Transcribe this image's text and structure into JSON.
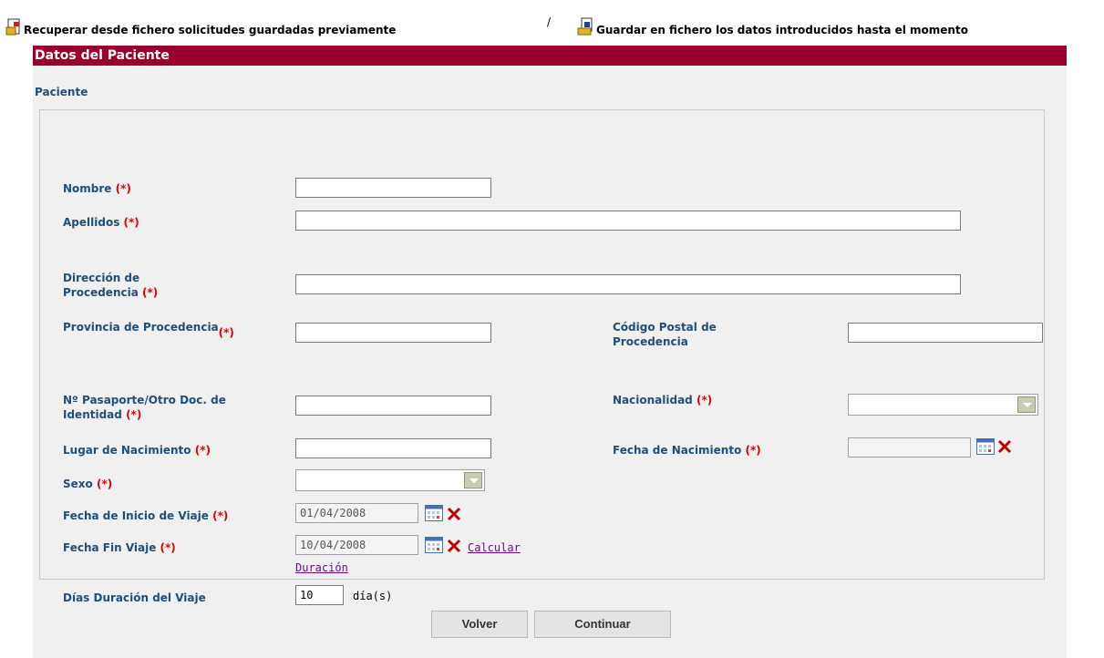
{
  "toolbar": {
    "recover_label": "Recuperar desde fichero solicitudes guardadas previamente",
    "separator": "/",
    "save_label": "Guardar en fichero los datos introducidos hasta el momento"
  },
  "panel": {
    "header": "Datos del Paciente",
    "section": "Paciente"
  },
  "form": {
    "required_marker": "(*)",
    "nombre": {
      "label": "Nombre",
      "value": ""
    },
    "apellidos": {
      "label": "Apellidos",
      "value": ""
    },
    "direccion": {
      "label_line1": "Dirección de",
      "label_line2": "Procedencia",
      "value": ""
    },
    "provincia": {
      "label": "Provincia de Procedencia",
      "value": ""
    },
    "codigo_postal": {
      "label_line1": "Código Postal de",
      "label_line2": "Procedencia",
      "value": ""
    },
    "pasaporte": {
      "label_line1": "Nº Pasaporte/Otro Doc. de",
      "label_line2": "Identidad",
      "value": ""
    },
    "nacionalidad": {
      "label": "Nacionalidad",
      "value": ""
    },
    "lugar_nacimiento": {
      "label": "Lugar de Nacimiento",
      "value": ""
    },
    "fecha_nacimiento": {
      "label": "Fecha de Nacimiento",
      "value": ""
    },
    "sexo": {
      "label": "Sexo",
      "value": ""
    },
    "fecha_inicio": {
      "label": "Fecha de Inicio de Viaje",
      "value": "01/04/2008"
    },
    "fecha_fin": {
      "label": "Fecha Fin Viaje",
      "value": "10/04/2008"
    },
    "calcular_link_line1": "Calcular",
    "calcular_link_line2": "Duración",
    "dias_duracion": {
      "label": "Días Duración del Viaje",
      "value": "10",
      "unit": "día(s)"
    }
  },
  "buttons": {
    "volver": "Volver",
    "continuar": "Continuar"
  },
  "colors": {
    "header_bg": "#99002e",
    "label_color": "#1f4e79",
    "required_color": "#e00000",
    "link_color": "#6a0b8a"
  },
  "icons": {
    "recover": "open-file-icon",
    "save": "save-file-icon",
    "calendar": "calendar-icon",
    "clear": "clear-x-icon",
    "dropdown": "chevron-down-icon"
  }
}
